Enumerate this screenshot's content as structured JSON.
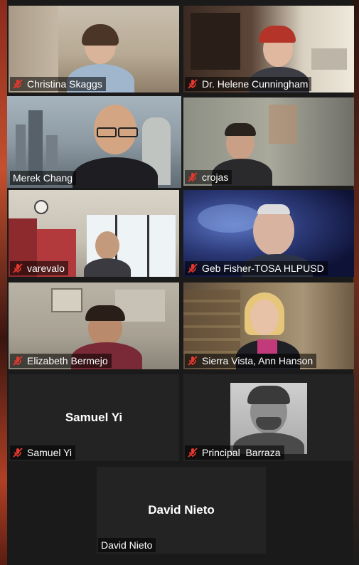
{
  "participants": [
    {
      "name": "Christina Skaggs",
      "muted": true
    },
    {
      "name": "Dr. Helene Cunningham",
      "muted": true
    },
    {
      "name": "Merek Chang",
      "muted": false,
      "active_speaker": true
    },
    {
      "name": "crojas",
      "muted": true
    },
    {
      "name": "varevalo",
      "muted": true
    },
    {
      "name": "Geb Fisher-TOSA HLPUSD",
      "muted": true
    },
    {
      "name": "Elizabeth Bermejo",
      "muted": true
    },
    {
      "name": "Sierra Vista, Ann Hanson",
      "muted": true
    },
    {
      "name": "Samuel Yi",
      "muted": true,
      "video_off": true
    },
    {
      "name": "Principal  Barraza",
      "muted": true
    },
    {
      "name": "David Nieto",
      "muted": false,
      "video_off": true
    }
  ],
  "colors": {
    "active_speaker_border": "#f2f25a",
    "mute_icon": "#e8382e",
    "tile_background": "#232323"
  }
}
